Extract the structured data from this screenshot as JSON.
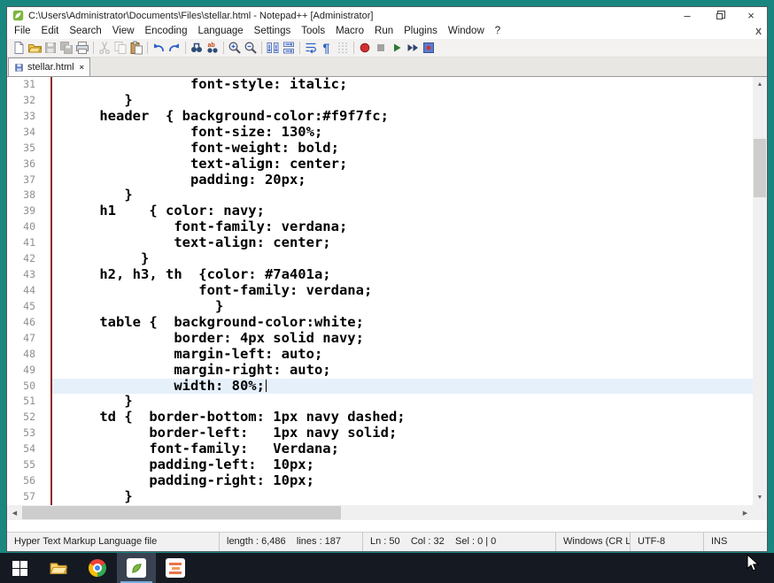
{
  "window": {
    "title": "C:\\Users\\Administrator\\Documents\\Files\\stellar.html - Notepad++ [Administrator]",
    "controls": {
      "minimize": "–",
      "close": "×"
    }
  },
  "menubar": {
    "items": [
      "File",
      "Edit",
      "Search",
      "View",
      "Encoding",
      "Language",
      "Settings",
      "Tools",
      "Macro",
      "Run",
      "Plugins",
      "Window",
      "?"
    ],
    "doc_close_label": "X"
  },
  "toolbar": {
    "buttons": [
      {
        "name": "new-file"
      },
      {
        "name": "open"
      },
      {
        "name": "save",
        "disabled": true
      },
      {
        "name": "save-all",
        "disabled": true
      },
      {
        "name": "print"
      },
      {
        "sep": true
      },
      {
        "name": "cut",
        "disabled": true
      },
      {
        "name": "copy",
        "disabled": true
      },
      {
        "name": "paste"
      },
      {
        "sep": true
      },
      {
        "name": "undo"
      },
      {
        "name": "redo"
      },
      {
        "sep": true
      },
      {
        "name": "find"
      },
      {
        "name": "replace"
      },
      {
        "sep": true
      },
      {
        "name": "zoom-in"
      },
      {
        "name": "zoom-out"
      },
      {
        "sep": true
      },
      {
        "name": "sync-vertical"
      },
      {
        "name": "sync-horizontal"
      },
      {
        "sep": true
      },
      {
        "name": "word-wrap"
      },
      {
        "name": "show-all-chars"
      },
      {
        "name": "indent-guide"
      },
      {
        "sep": true
      },
      {
        "name": "record-macro"
      },
      {
        "name": "stop-macro",
        "disabled": true
      },
      {
        "name": "play-macro"
      },
      {
        "name": "run-macro-multi"
      },
      {
        "name": "save-macro"
      }
    ]
  },
  "tabbar": {
    "tabs": [
      {
        "label": "stellar.html",
        "active": true,
        "close_glyph": "×"
      }
    ]
  },
  "editor": {
    "current_line": 50,
    "lines": [
      {
        "n": 31,
        "t": "               font-style: italic;"
      },
      {
        "n": 32,
        "t": "       }"
      },
      {
        "n": 33,
        "t": "    header  { background-color:#f9f7fc;"
      },
      {
        "n": 34,
        "t": "               font-size: 130%;"
      },
      {
        "n": 35,
        "t": "               font-weight: bold;"
      },
      {
        "n": 36,
        "t": "               text-align: center;"
      },
      {
        "n": 37,
        "t": "               padding: 20px;"
      },
      {
        "n": 38,
        "t": "       }"
      },
      {
        "n": 39,
        "t": "    h1    { color: navy;"
      },
      {
        "n": 40,
        "t": "             font-family: verdana;"
      },
      {
        "n": 41,
        "t": "             text-align: center;"
      },
      {
        "n": 42,
        "t": "         }"
      },
      {
        "n": 43,
        "t": "    h2, h3, th  {color: #7a401a;"
      },
      {
        "n": 44,
        "t": "                font-family: verdana;"
      },
      {
        "n": 45,
        "t": "                  }"
      },
      {
        "n": 46,
        "t": "    table {  background-color:white;"
      },
      {
        "n": 47,
        "t": "             border: 4px solid navy;"
      },
      {
        "n": 48,
        "t": "             margin-left: auto;"
      },
      {
        "n": 49,
        "t": "             margin-right: auto;"
      },
      {
        "n": 50,
        "t": "             width: 80%;"
      },
      {
        "n": 51,
        "t": "       }"
      },
      {
        "n": 52,
        "t": "    td {  border-bottom: 1px navy dashed;"
      },
      {
        "n": 53,
        "t": "          border-left:   1px navy solid;"
      },
      {
        "n": 54,
        "t": "          font-family:   Verdana;"
      },
      {
        "n": 55,
        "t": "          padding-left:  10px;"
      },
      {
        "n": 56,
        "t": "          padding-right: 10px;"
      },
      {
        "n": 57,
        "t": "       }"
      }
    ]
  },
  "scrollbars": {
    "up": "▲",
    "down": "▼",
    "left": "◀",
    "right": "▶"
  },
  "statusbar": {
    "doc_type": "Hyper Text Markup Language file",
    "length_lines": "length : 6,486    lines : 187",
    "position": "Ln : 50    Col : 32    Sel : 0 | 0",
    "eol": "Windows (CR LF)",
    "encoding": "UTF-8",
    "mode": "INS"
  },
  "taskbar": {
    "buttons": [
      {
        "name": "start"
      },
      {
        "name": "file-explorer"
      },
      {
        "name": "chrome"
      },
      {
        "name": "notepad-plus-plus",
        "active": true
      },
      {
        "name": "orange-document"
      }
    ]
  }
}
